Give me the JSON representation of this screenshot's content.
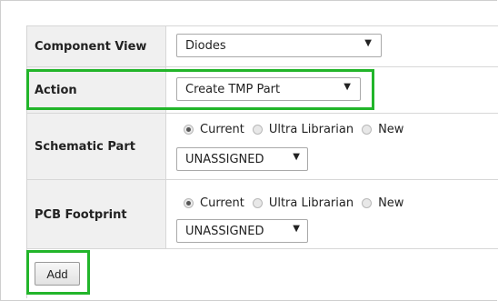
{
  "component_view": {
    "label": "Component View",
    "selected": "Diodes"
  },
  "action": {
    "label": "Action",
    "selected": "Create TMP Part"
  },
  "schematic_part": {
    "label": "Schematic Part",
    "options": [
      "Current",
      "Ultra Librarian",
      "New"
    ],
    "selected_option": "Current",
    "dropdown": "UNASSIGNED"
  },
  "pcb_footprint": {
    "label": "PCB Footprint",
    "options": [
      "Current",
      "Ultra Librarian",
      "New"
    ],
    "selected_option": "Current",
    "dropdown": "UNASSIGNED"
  },
  "add_button": "Add",
  "icons": {
    "dropdown": "caret-down-icon"
  },
  "colors": {
    "highlight": "#22b52a",
    "label_background": "#f0f0f0"
  }
}
